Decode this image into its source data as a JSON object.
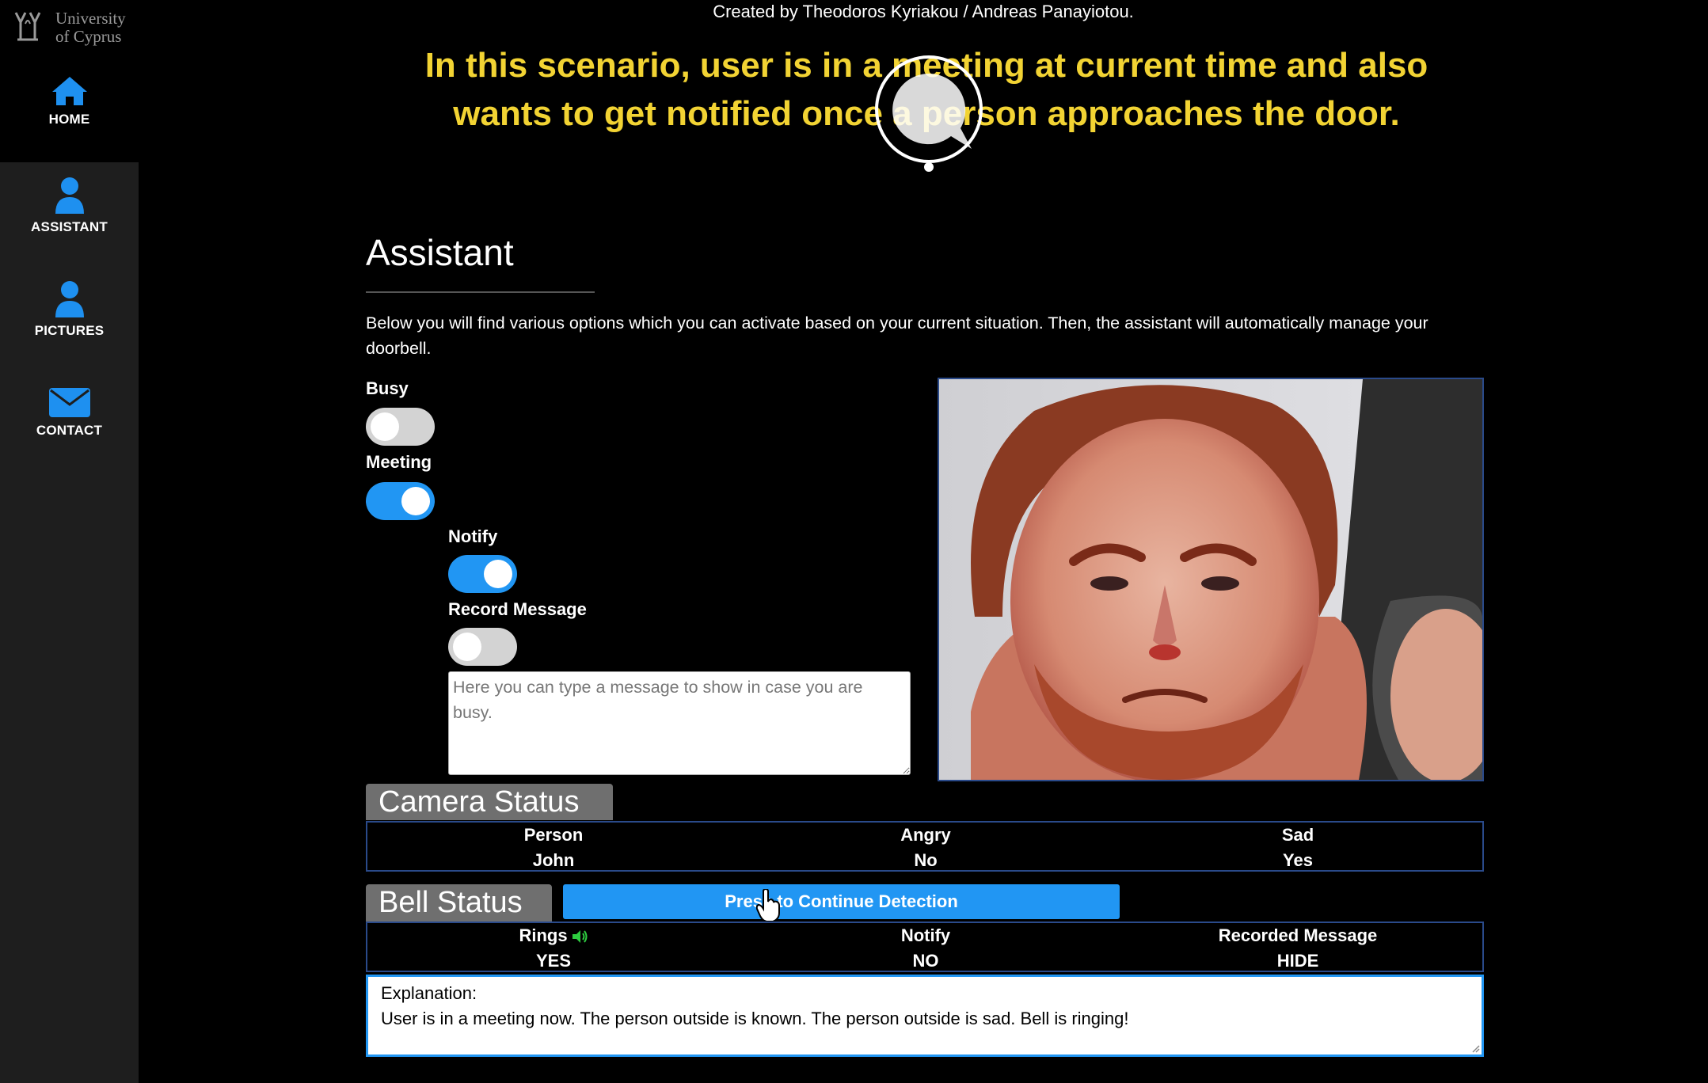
{
  "sidebar": {
    "logo_text_line1": "University",
    "logo_text_line2": "of Cyprus",
    "items": [
      {
        "label": "HOME",
        "icon": "home-icon"
      },
      {
        "label": "ASSISTANT",
        "icon": "user-icon"
      },
      {
        "label": "PICTURES",
        "icon": "user-icon"
      },
      {
        "label": "CONTACT",
        "icon": "envelope-icon"
      }
    ]
  },
  "header": {
    "credits": "Created by Theodoros Kyriakou / Andreas Panayiotou.",
    "caption_line1": "In this scenario, user is in a meeting at current time and also",
    "caption_line2": "wants to get notified once a person approaches the door."
  },
  "assistant": {
    "title": "Assistant",
    "intro": "Below you will find various options which you can activate based on your current situation. Then, the assistant will automatically manage your doorbell.",
    "options": {
      "busy": {
        "label": "Busy",
        "on": false
      },
      "meeting": {
        "label": "Meeting",
        "on": true
      },
      "notify": {
        "label": "Notify",
        "on": true
      },
      "record_message": {
        "label": "Record Message",
        "on": false
      }
    },
    "message_placeholder": "Here you can type a message to show in case you are busy."
  },
  "camera_status": {
    "title": "Camera Status",
    "headers": [
      "Person",
      "Angry",
      "Sad"
    ],
    "values": [
      "John",
      "No",
      "Yes"
    ]
  },
  "bell_status": {
    "title": "Bell Status",
    "continue_button": "Press to Continue Detection",
    "headers": [
      "Rings",
      "Notify",
      "Recorded Message"
    ],
    "values": [
      "YES",
      "NO",
      "HIDE"
    ]
  },
  "explanation": {
    "label": "Explanation:",
    "text": "User is in a meeting now. The person outside is known. The person outside is sad. Bell is ringing!"
  },
  "colors": {
    "accent": "#2196f3",
    "caption": "#f2d333",
    "sidebar": "#1e1e1e",
    "panel_tab": "#6f6f6f"
  }
}
